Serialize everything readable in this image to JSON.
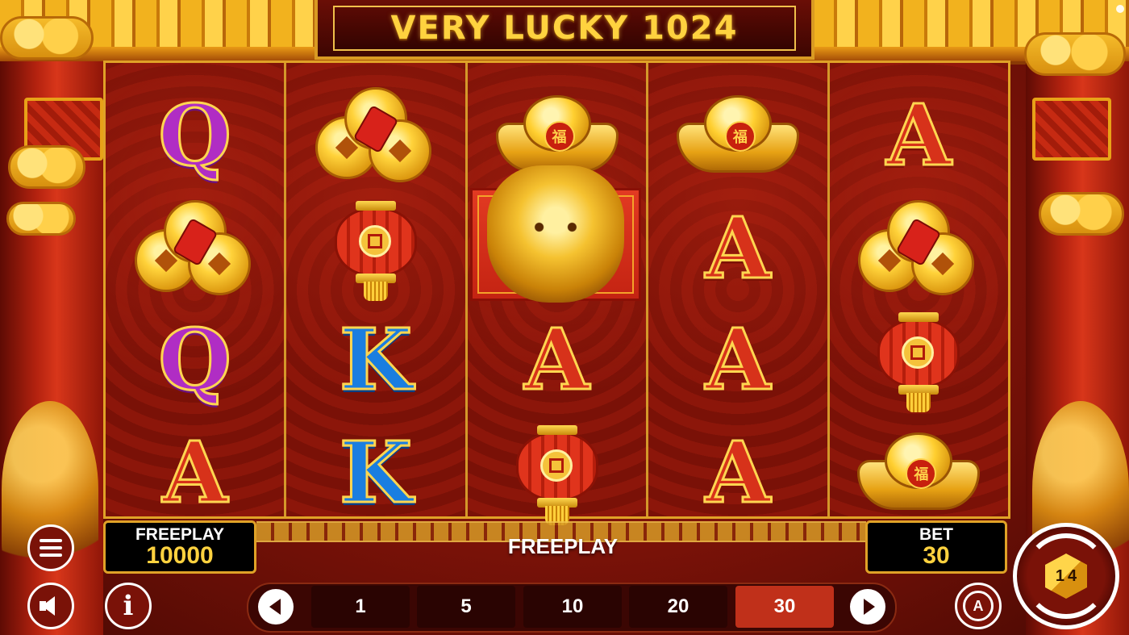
{
  "game": {
    "title": "VERY LUCKY 1024"
  },
  "reels": [
    [
      "Q",
      "coins",
      "Q",
      "A"
    ],
    [
      "coins",
      "lantern",
      "K",
      "K"
    ],
    [
      "ingot",
      "dragon-wild",
      "A",
      "lantern"
    ],
    [
      "ingot",
      "A",
      "A",
      "A"
    ],
    [
      "A",
      "coins",
      "lantern",
      "ingot"
    ]
  ],
  "ingot_seal_char": "福",
  "freeplay_panel": {
    "label": "FREEPLAY",
    "value": "10000"
  },
  "status_message": "FREEPLAY",
  "bet_panel": {
    "label": "BET",
    "value": "30"
  },
  "bet_options": [
    "1",
    "5",
    "10",
    "20",
    "30"
  ],
  "selected_bet": "30",
  "autoplay_label": "A",
  "info_label": "i",
  "spin_badge": {
    "left": "1",
    "right": "4"
  },
  "colors": {
    "gold": "#ffd23f",
    "frame": "#e0a227",
    "active_bet": "#c0301a",
    "background": "#7d1007"
  }
}
